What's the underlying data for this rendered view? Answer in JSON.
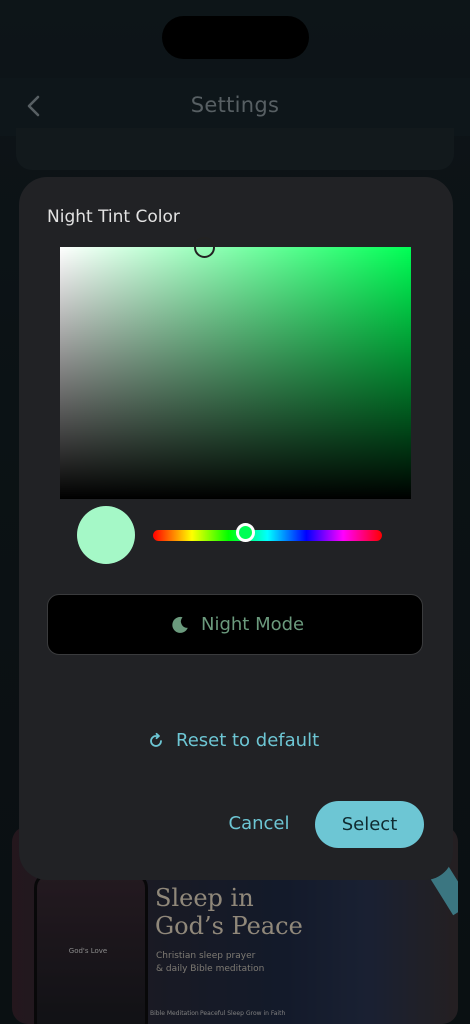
{
  "header": {
    "title": "Settings",
    "back_icon": "chevron-left-icon"
  },
  "background_promo": {
    "title_line1": "Sleep in",
    "title_line2": "God’s Peace",
    "subtitle_line1": "Christian sleep prayer",
    "subtitle_line2": "& daily Bible meditation",
    "phone_label": "God's Love",
    "nav_items": [
      "Bible Meditation",
      "Peaceful Sleep",
      "Grow in Faith"
    ]
  },
  "dialog": {
    "title": "Night Tint Color",
    "selected_color": "#a5f8c7",
    "pure_hue_color": "#00ff55",
    "hue_position": 0.4,
    "night_mode_button": {
      "label": "Night Mode",
      "icon": "moon-icon",
      "color": "#6b9a7d"
    },
    "reset": {
      "label": "Reset to default",
      "icon": "refresh-icon",
      "color": "#6dc6d4"
    },
    "cancel_label": "Cancel",
    "select_label": "Select",
    "accent_color": "#6dc6d4"
  }
}
